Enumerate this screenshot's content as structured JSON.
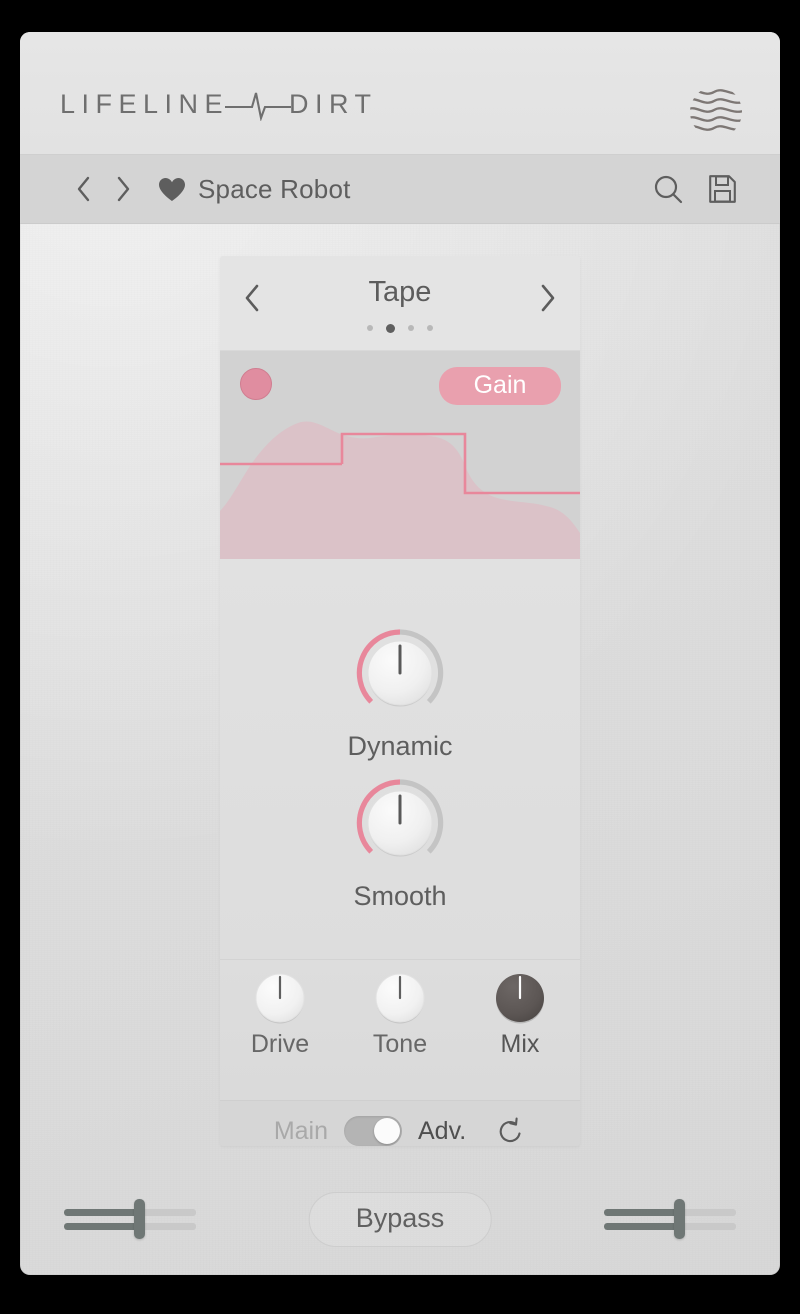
{
  "brand": {
    "name_left": "LIFELINE",
    "name_right": "DIRT",
    "pulse_icon": "ecg-pulse-icon",
    "mark_icon": "wavy-sphere-logo-icon"
  },
  "preset_bar": {
    "prev_icon": "chevron-left-icon",
    "next_icon": "chevron-right-icon",
    "favorite_icon": "heart-icon",
    "preset_name": "Space Robot",
    "search_icon": "search-icon",
    "save_icon": "save-floppy-icon"
  },
  "module": {
    "prev_icon": "chevron-left-icon",
    "next_icon": "chevron-right-icon",
    "title": "Tape",
    "pages": {
      "count": 4,
      "active_index": 1
    },
    "graph": {
      "meter_dot_label": "level-indicator",
      "badge_label": "Gain",
      "accent_color": "#e9a0ae",
      "fill_color": "#e7c3cb",
      "panel_color": "#d2d2d2"
    },
    "large_knobs": [
      {
        "label": "Dynamic",
        "value_pct": 50,
        "arc_color": "#e8879b"
      },
      {
        "label": "Smooth",
        "value_pct": 50,
        "arc_color": "#e8879b"
      }
    ],
    "small_knobs": [
      {
        "label": "Drive",
        "value_pct": 50,
        "style": "light"
      },
      {
        "label": "Tone",
        "value_pct": 50,
        "style": "light"
      },
      {
        "label": "Mix",
        "value_pct": 50,
        "style": "dark"
      }
    ],
    "footer": {
      "main_label": "Main",
      "adv_label": "Adv.",
      "toggle_state": "adv",
      "reset_icon": "undo-reset-icon"
    }
  },
  "bottom_bar": {
    "input_slider": {
      "name": "input-gain-slider",
      "value_pct": 57
    },
    "bypass_label": "Bypass",
    "output_slider": {
      "name": "output-gain-slider",
      "value_pct": 57
    }
  }
}
